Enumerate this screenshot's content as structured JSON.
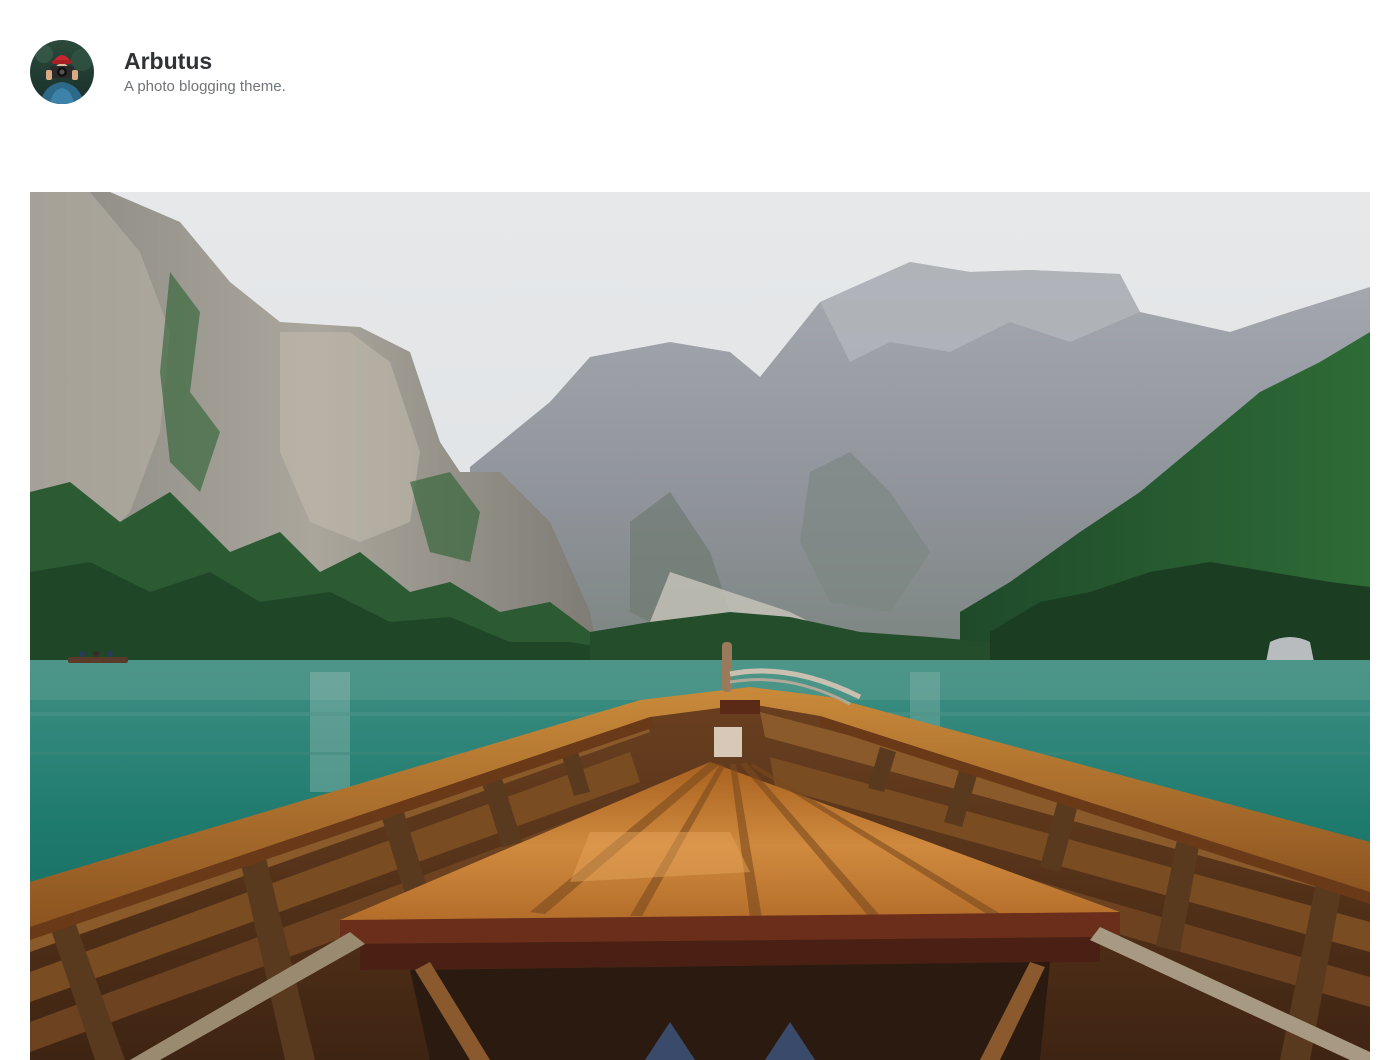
{
  "site": {
    "title": "Arbutus",
    "description": "A photo blogging theme."
  },
  "colors": {
    "title": "#2f3336",
    "description": "#70757a",
    "background": "#ffffff"
  }
}
